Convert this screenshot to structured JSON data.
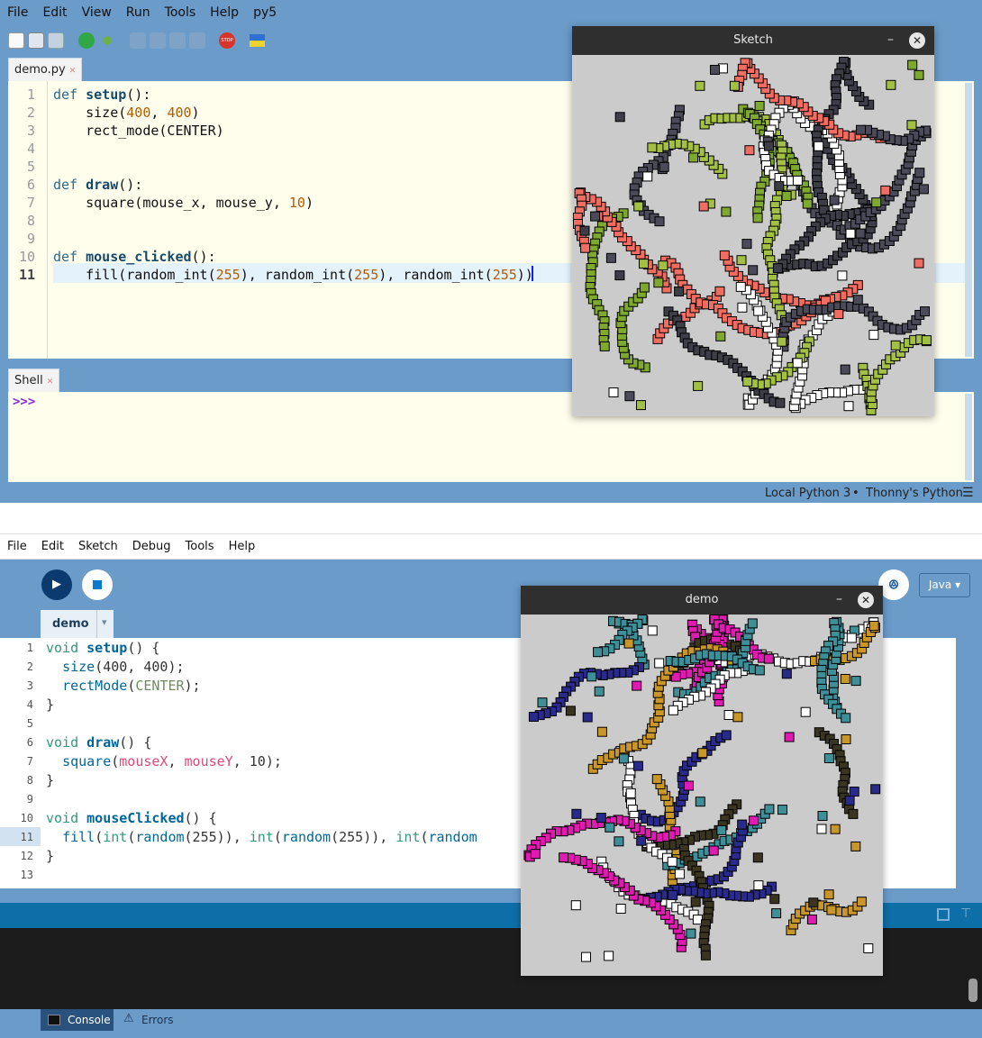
{
  "thonny": {
    "menu": [
      "File",
      "Edit",
      "View",
      "Run",
      "Tools",
      "Help",
      "py5"
    ],
    "editor_tab": "demo.py",
    "code_lines": [
      {
        "n": "1",
        "html": "<span class=\"kw\">def</span> <span class=\"fn\">setup</span>():"
      },
      {
        "n": "2",
        "html": "    size(<span class=\"num\">400</span>, <span class=\"num\">400</span>)"
      },
      {
        "n": "3",
        "html": "    rect_mode(CENTER)"
      },
      {
        "n": "4",
        "html": ""
      },
      {
        "n": "5",
        "html": ""
      },
      {
        "n": "6",
        "html": "<span class=\"kw\">def</span> <span class=\"fn\">draw</span>():"
      },
      {
        "n": "7",
        "html": "    square(mouse_x, mouse_y, <span class=\"num\">10</span>)"
      },
      {
        "n": "8",
        "html": ""
      },
      {
        "n": "9",
        "html": ""
      },
      {
        "n": "10",
        "html": "<span class=\"kw\">def</span> <span class=\"fn\">mouse_clicked</span>():"
      },
      {
        "n": "11",
        "html": "    fill(random_int(<span class=\"num\">255</span>), random_int(<span class=\"num\">255</span>), random_int(<span class=\"num\">255</span>))"
      }
    ],
    "shell_tab": "Shell",
    "shell_prompt": ">>>",
    "status_interpreter": "Local Python 3",
    "status_separator": "•",
    "status_app": "Thonny's Python",
    "sketch_title": "Sketch",
    "sketch_colors": [
      "#f06d62",
      "#a3c045",
      "#4a4a58",
      "#ffffff",
      "#7fa82e",
      "#3d3d47"
    ]
  },
  "processing": {
    "menu": [
      "File",
      "Edit",
      "Sketch",
      "Debug",
      "Tools",
      "Help"
    ],
    "tab_name": "demo",
    "mode": "Java",
    "mode_arrow": "▾",
    "code_lines": [
      {
        "n": "1",
        "html": "<span class=\"pk\">void</span> <span class=\"pf\">setup</span>() {"
      },
      {
        "n": "2",
        "html": "  <span class=\"pb\">size</span>(400, 400);"
      },
      {
        "n": "3",
        "html": "  <span class=\"pb\">rectMode</span>(<span class=\"pc\" style=\"color:#718a62\">CENTER</span>);"
      },
      {
        "n": "4",
        "html": "}"
      },
      {
        "n": "5",
        "html": ""
      },
      {
        "n": "6",
        "html": "<span class=\"pk\">void</span> <span class=\"pf\">draw</span>() {"
      },
      {
        "n": "7",
        "html": "  <span class=\"pb\">square</span>(<span class=\"pv\">mouseX</span>, <span class=\"pv\">mouseY</span>, 10);"
      },
      {
        "n": "8",
        "html": "}"
      },
      {
        "n": "9",
        "html": ""
      },
      {
        "n": "10",
        "html": "<span class=\"pk\">void</span> <span class=\"pf\">mouseClicked</span>() {"
      },
      {
        "n": "11",
        "html": "  <span class=\"pb\">fill</span>(<span class=\"pk\">int</span>(<span class=\"pb\">random</span>(255)), <span class=\"pk\">int</span>(<span class=\"pb\">random</span>(255)), <span class=\"pk\">int</span>(<span class=\"pb\">random</span>"
      },
      {
        "n": "12",
        "html": "}"
      },
      {
        "n": "13",
        "html": ""
      }
    ],
    "console_tab": "Console",
    "errors_tab": "Errors",
    "sketch_title": "demo",
    "sketch_colors": [
      "#e01bb0",
      "#3f8f99",
      "#3a3520",
      "#ffffff",
      "#2a2a8a",
      "#c9962a"
    ]
  }
}
